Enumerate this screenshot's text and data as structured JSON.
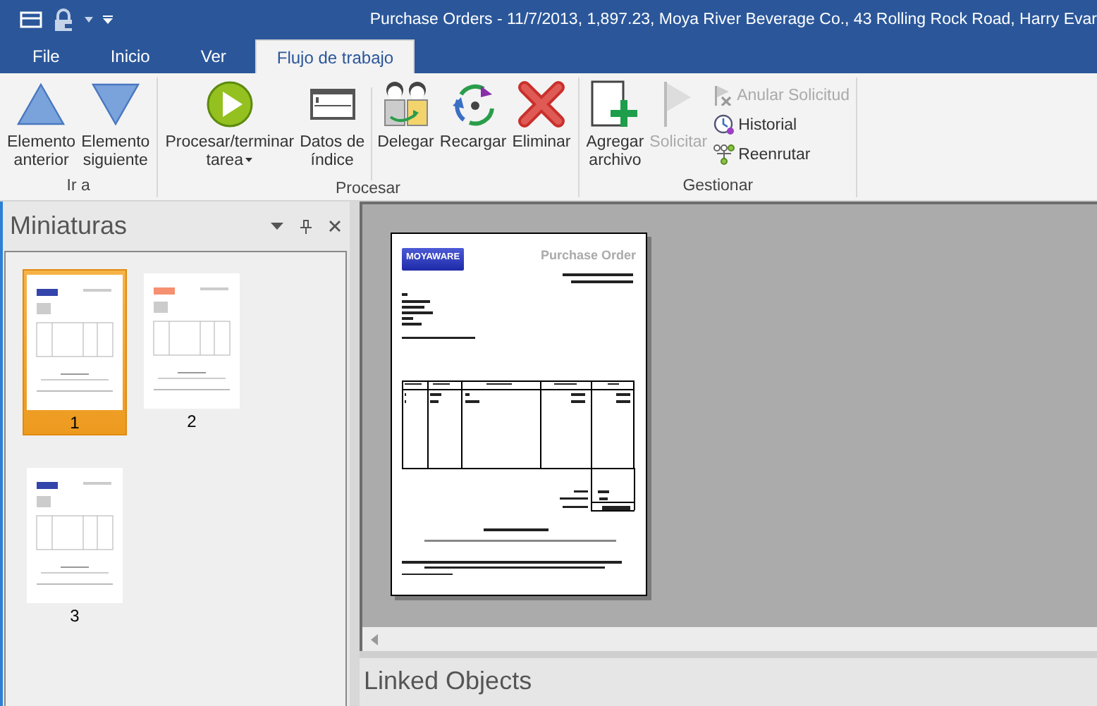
{
  "window": {
    "title": "Purchase Orders - 11/7/2013, 1,897.23, Moya River Beverage Co., 43 Rolling Rock Road, Harry Evar"
  },
  "tabs": [
    {
      "label": "File",
      "selected": false
    },
    {
      "label": "Inicio",
      "selected": false
    },
    {
      "label": "Ver",
      "selected": false
    },
    {
      "label": "Flujo de trabajo",
      "selected": true
    }
  ],
  "ribbon": {
    "groups": [
      {
        "label": "Ir a",
        "buttons": [
          {
            "kind": "large",
            "lines": [
              "Elemento",
              "anterior"
            ],
            "disabled": false
          },
          {
            "kind": "large",
            "lines": [
              "Elemento",
              "siguiente"
            ],
            "disabled": false
          }
        ]
      },
      {
        "label": "Procesar",
        "buttons": [
          {
            "kind": "dropdown",
            "lines": [
              "Procesar/terminar",
              "tarea"
            ],
            "disabled": false
          },
          {
            "kind": "large",
            "lines": [
              "Datos de",
              "índice"
            ],
            "disabled": false
          },
          {
            "kind": "separator"
          },
          {
            "kind": "large",
            "lines": [
              "Delegar"
            ],
            "disabled": false
          },
          {
            "kind": "large",
            "lines": [
              "Recargar"
            ],
            "disabled": false
          },
          {
            "kind": "large",
            "lines": [
              "Eliminar"
            ],
            "disabled": false
          }
        ]
      },
      {
        "label": "Gestionar",
        "buttons": [
          {
            "kind": "large",
            "lines": [
              "Agregar",
              "archivo"
            ],
            "disabled": false
          },
          {
            "kind": "large",
            "lines": [
              "Solicitar"
            ],
            "disabled": true
          },
          {
            "kind": "small",
            "lines": [
              "Anular Solicitud"
            ],
            "disabled": true
          },
          {
            "kind": "small",
            "lines": [
              "Historial"
            ],
            "disabled": false
          },
          {
            "kind": "small",
            "lines": [
              "Reenrutar"
            ],
            "disabled": false
          }
        ]
      }
    ]
  },
  "thumbnails": {
    "title": "Miniaturas",
    "pages": [
      {
        "label": "1",
        "selected": true
      },
      {
        "label": "2",
        "selected": false
      },
      {
        "label": "3",
        "selected": false
      }
    ]
  },
  "viewer": {
    "document": {
      "logo": "MOYAWARE",
      "heading": "Purchase Order"
    }
  },
  "linked_objects": {
    "title": "Linked Objects"
  }
}
